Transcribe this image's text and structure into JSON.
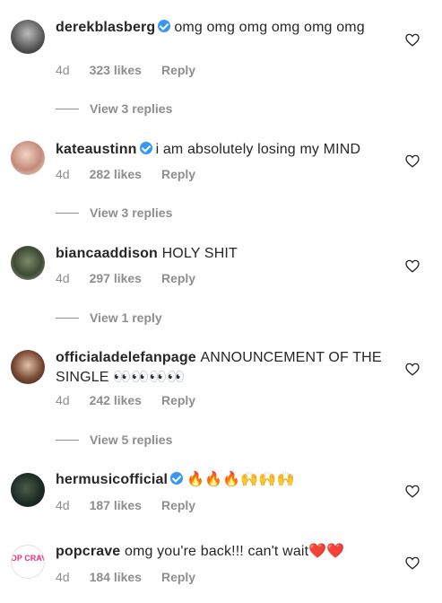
{
  "comments": [
    {
      "username": "derekblasberg",
      "verified": true,
      "text": "omg omg omg omg omg omg",
      "time": "4d",
      "likes": "323 likes",
      "reply": "Reply",
      "view_replies": "View 3 replies"
    },
    {
      "username": "kateaustinn",
      "verified": true,
      "text": "i am absolutely losing my MIND",
      "time": "4d",
      "likes": "282 likes",
      "reply": "Reply",
      "view_replies": "View 3 replies"
    },
    {
      "username": "biancaaddison",
      "verified": false,
      "text": "HOLY SHIT",
      "time": "4d",
      "likes": "297 likes",
      "reply": "Reply",
      "view_replies": "View 1 reply"
    },
    {
      "username": "officialadelefanpage",
      "verified": false,
      "text": "ANNOUNCEMENT OF THE SINGLE 👀👀👀👀",
      "time": "4d",
      "likes": "242 likes",
      "reply": "Reply",
      "view_replies": "View 5 replies"
    },
    {
      "username": "hermusicofficial",
      "verified": true,
      "text": "🔥🔥🔥🙌🙌🙌",
      "time": "4d",
      "likes": "187 likes",
      "reply": "Reply"
    },
    {
      "username": "popcrave",
      "verified": false,
      "text": "omg you're back!!! can't wait❤️❤️",
      "time": "4d",
      "likes": "184 likes",
      "reply": "Reply",
      "avatar_text": "POP CRAVE"
    }
  ],
  "icons": {
    "like": "heart-outline-icon",
    "verified": "verified-badge-icon"
  },
  "colors": {
    "verified": "#3897f0",
    "meta": "#8e8e8e",
    "text": "#262626"
  }
}
